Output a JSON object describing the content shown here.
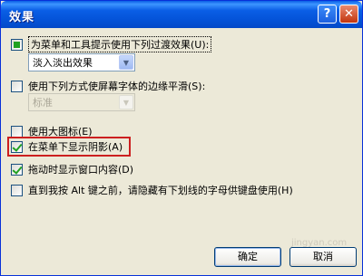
{
  "window": {
    "title": "效果",
    "help_glyph": "?",
    "close_glyph": "✕"
  },
  "options": {
    "transition_label": "为菜单和工具提示使用下列过渡效果",
    "transition_hotkey": "(U):",
    "transition_value": "淡入淡出效果",
    "smoothing_label": "使用下列方式使屏幕字体的边缘平滑",
    "smoothing_hotkey": "(S):",
    "smoothing_value": "标准",
    "large_icons_label": "使用大图标",
    "large_icons_hotkey": "(E)",
    "menu_shadow_label": "在菜单下显示阴影",
    "menu_shadow_hotkey": "(A)",
    "drag_contents_label": "拖动时显示窗口内容",
    "drag_contents_hotkey": "(D)",
    "hide_underline_label": "直到我按 Alt 键之前，请隐藏有下划线的字母供键盘使用",
    "hide_underline_hotkey": "(H)"
  },
  "buttons": {
    "ok": "确定",
    "cancel": "取消"
  },
  "watermark": "jingyan.com"
}
